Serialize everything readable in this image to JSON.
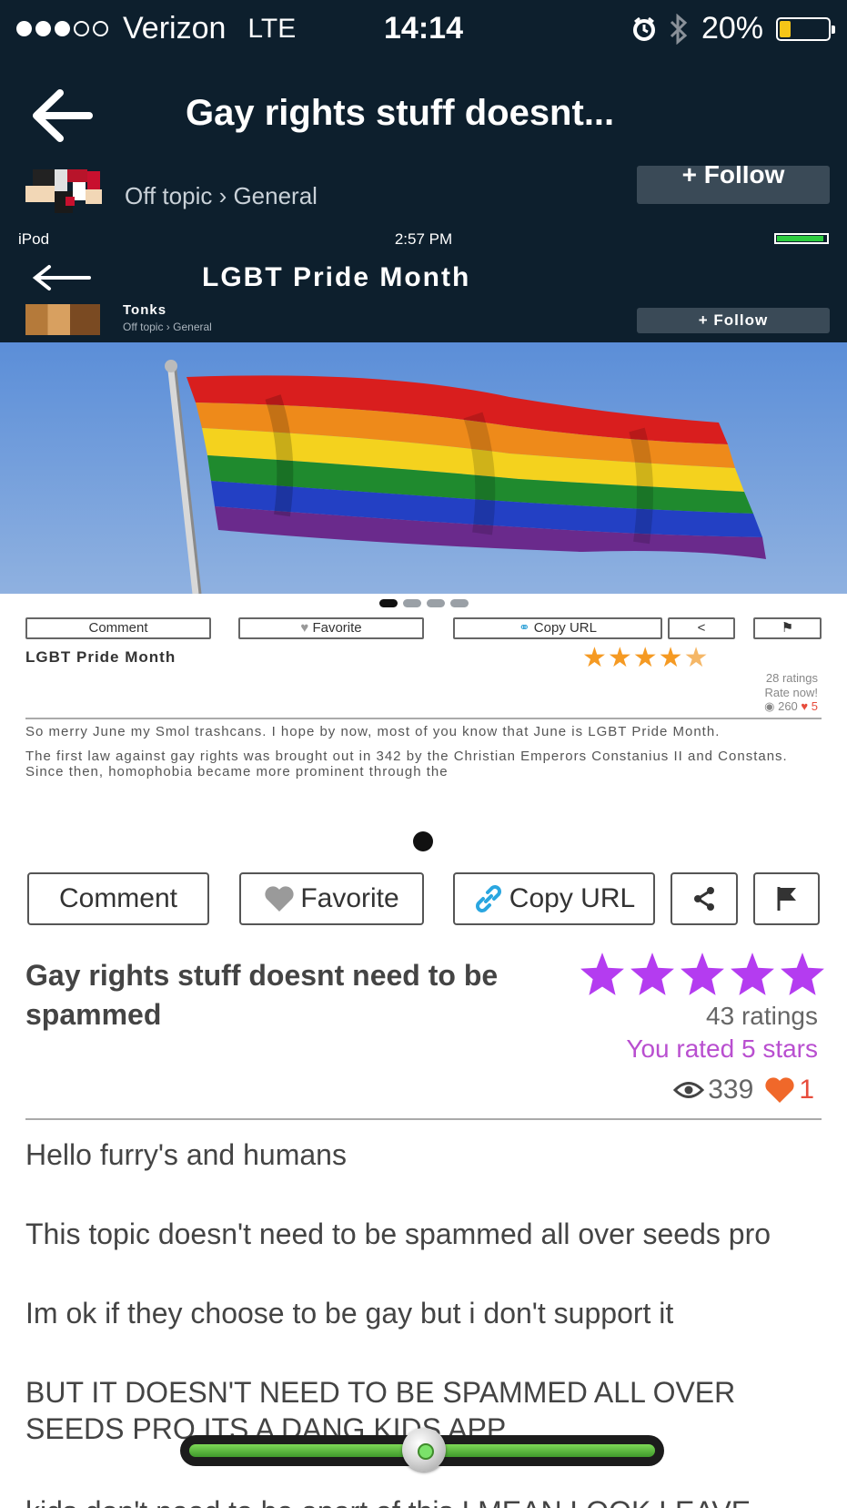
{
  "status_bar": {
    "carrier": "Verizon",
    "network": "LTE",
    "time": "14:14",
    "battery": "20%",
    "battery_level": 0.2,
    "icons": [
      "signal-dots-icon",
      "alarm-icon",
      "bluetooth-icon",
      "battery-icon"
    ]
  },
  "nav": {
    "title": "Gay rights stuff doesnt...",
    "breadcrumb": "Off topic › General",
    "follow_label": "+ Follow"
  },
  "embedded": {
    "status_left": "iPod",
    "status_time": "2:57 PM",
    "title": "LGBT Pride Month",
    "author": "Tonks",
    "breadcrumb": "Off topic › General",
    "follow_label": "+ Follow",
    "actions": {
      "comment": "Comment",
      "favorite": "Favorite",
      "copy_url": "Copy URL"
    },
    "post_title": "LGBT Pride Month",
    "ratings": "28 ratings",
    "rate_now": "Rate now!",
    "views": "260",
    "likes": "5",
    "paragraphs": [
      "So merry June my Smol trashcans. I hope by now, most of you know that June is LGBT Pride Month.",
      "The first law against gay rights was brought out in 342 by the Christian Emperors Constanius II and Constans. Since then, homophobia became more prominent through the"
    ]
  },
  "actions": {
    "comment": "Comment",
    "favorite": "Favorite",
    "copy_url": "Copy URL"
  },
  "post": {
    "title": "Gay rights stuff doesnt need to be spammed",
    "star_rating": 5,
    "ratings": "43 ratings",
    "you_rated": "You rated 5 stars",
    "views": "339",
    "likes": "1",
    "paragraphs": [
      "Hello furry's and humans",
      "This topic doesn't need to be spammed all over seeds pro",
      "Im ok if they choose to be gay but i don't support it",
      "BUT IT DOESN'T NEED TO BE SPAMMED ALL OVER SEEDS PRO ITS A DANG KIDS APP"
    ],
    "cut_line": "kids don't need to be apart of this I MEAN LOOK LEAVE"
  },
  "colors": {
    "nav_bg": "#0d1f2d",
    "accent_purple": "#b94fd0",
    "star_purple": "#b43cf0",
    "heart_red": "#e74c3c"
  }
}
